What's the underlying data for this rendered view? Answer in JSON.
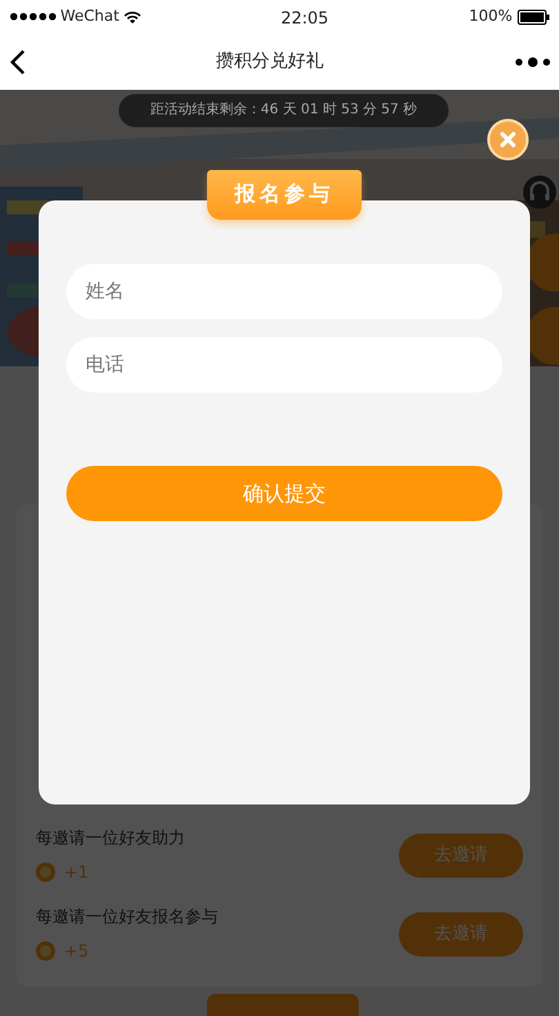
{
  "status_bar": {
    "carrier": "WeChat",
    "time": "22:05",
    "battery": "100%"
  },
  "nav": {
    "title": "攒积分兑好礼"
  },
  "countdown": "距活动结束剩余：46 天 01 时 53 分 57 秒",
  "tasks": [
    {
      "title": "每邀请一位好友助力",
      "points": "+1",
      "action": "去邀请"
    },
    {
      "title": "每邀请一位好友报名参与",
      "points": "+5",
      "action": "去邀请"
    }
  ],
  "modal": {
    "title": "报名参与",
    "fields": [
      {
        "placeholder": "姓名"
      },
      {
        "placeholder": "电话"
      }
    ],
    "submit": "确认提交"
  }
}
